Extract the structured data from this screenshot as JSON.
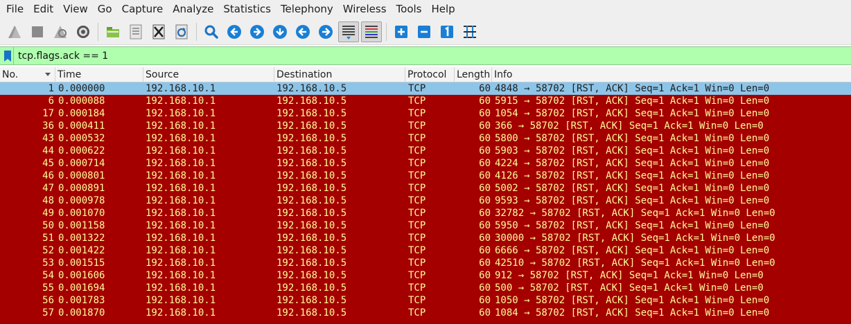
{
  "menu": [
    "File",
    "Edit",
    "View",
    "Go",
    "Capture",
    "Analyze",
    "Statistics",
    "Telephony",
    "Wireless",
    "Tools",
    "Help"
  ],
  "toolbar": {
    "icons": [
      "start-capture-icon",
      "stop-capture-icon",
      "restart-capture-icon",
      "capture-options-icon",
      "open-file-icon",
      "save-file-icon",
      "close-file-icon",
      "reload-file-icon",
      "find-packet-icon",
      "go-back-icon",
      "go-forward-icon",
      "go-to-packet-icon",
      "go-first-icon",
      "go-last-icon",
      "autoscroll-icon",
      "colorize-icon",
      "zoom-in-icon",
      "zoom-out-icon",
      "normal-size-icon",
      "resize-columns-icon"
    ]
  },
  "filter": {
    "value": "tcp.flags.ack == 1"
  },
  "columns": [
    "No.",
    "Time",
    "Source",
    "Destination",
    "Protocol",
    "Length",
    "Info"
  ],
  "colors": {
    "rst_bg": "#a40000",
    "rst_fg": "#fffc9c",
    "selected_bg": "#8dc5e8",
    "filter_ok_bg": "#afffaf"
  },
  "packets": [
    {
      "no": "1",
      "time": "0.000000",
      "src": "192.168.10.1",
      "dst": "192.168.10.5",
      "proto": "TCP",
      "len": "60",
      "info": "4848 → 58702 [RST, ACK] Seq=1 Ack=1 Win=0 Len=0",
      "selected": true
    },
    {
      "no": "6",
      "time": "0.000088",
      "src": "192.168.10.1",
      "dst": "192.168.10.5",
      "proto": "TCP",
      "len": "60",
      "info": "5915 → 58702 [RST, ACK] Seq=1 Ack=1 Win=0 Len=0"
    },
    {
      "no": "17",
      "time": "0.000184",
      "src": "192.168.10.1",
      "dst": "192.168.10.5",
      "proto": "TCP",
      "len": "60",
      "info": "1054 → 58702 [RST, ACK] Seq=1 Ack=1 Win=0 Len=0"
    },
    {
      "no": "36",
      "time": "0.000411",
      "src": "192.168.10.1",
      "dst": "192.168.10.5",
      "proto": "TCP",
      "len": "60",
      "info": "366 → 58702 [RST, ACK] Seq=1 Ack=1 Win=0 Len=0"
    },
    {
      "no": "43",
      "time": "0.000532",
      "src": "192.168.10.1",
      "dst": "192.168.10.5",
      "proto": "TCP",
      "len": "60",
      "info": "5800 → 58702 [RST, ACK] Seq=1 Ack=1 Win=0 Len=0"
    },
    {
      "no": "44",
      "time": "0.000622",
      "src": "192.168.10.1",
      "dst": "192.168.10.5",
      "proto": "TCP",
      "len": "60",
      "info": "5903 → 58702 [RST, ACK] Seq=1 Ack=1 Win=0 Len=0"
    },
    {
      "no": "45",
      "time": "0.000714",
      "src": "192.168.10.1",
      "dst": "192.168.10.5",
      "proto": "TCP",
      "len": "60",
      "info": "4224 → 58702 [RST, ACK] Seq=1 Ack=1 Win=0 Len=0"
    },
    {
      "no": "46",
      "time": "0.000801",
      "src": "192.168.10.1",
      "dst": "192.168.10.5",
      "proto": "TCP",
      "len": "60",
      "info": "4126 → 58702 [RST, ACK] Seq=1 Ack=1 Win=0 Len=0"
    },
    {
      "no": "47",
      "time": "0.000891",
      "src": "192.168.10.1",
      "dst": "192.168.10.5",
      "proto": "TCP",
      "len": "60",
      "info": "5002 → 58702 [RST, ACK] Seq=1 Ack=1 Win=0 Len=0"
    },
    {
      "no": "48",
      "time": "0.000978",
      "src": "192.168.10.1",
      "dst": "192.168.10.5",
      "proto": "TCP",
      "len": "60",
      "info": "9593 → 58702 [RST, ACK] Seq=1 Ack=1 Win=0 Len=0"
    },
    {
      "no": "49",
      "time": "0.001070",
      "src": "192.168.10.1",
      "dst": "192.168.10.5",
      "proto": "TCP",
      "len": "60",
      "info": "32782 → 58702 [RST, ACK] Seq=1 Ack=1 Win=0 Len=0"
    },
    {
      "no": "50",
      "time": "0.001158",
      "src": "192.168.10.1",
      "dst": "192.168.10.5",
      "proto": "TCP",
      "len": "60",
      "info": "5950 → 58702 [RST, ACK] Seq=1 Ack=1 Win=0 Len=0"
    },
    {
      "no": "51",
      "time": "0.001322",
      "src": "192.168.10.1",
      "dst": "192.168.10.5",
      "proto": "TCP",
      "len": "60",
      "info": "30000 → 58702 [RST, ACK] Seq=1 Ack=1 Win=0 Len=0"
    },
    {
      "no": "52",
      "time": "0.001422",
      "src": "192.168.10.1",
      "dst": "192.168.10.5",
      "proto": "TCP",
      "len": "60",
      "info": "6666 → 58702 [RST, ACK] Seq=1 Ack=1 Win=0 Len=0"
    },
    {
      "no": "53",
      "time": "0.001515",
      "src": "192.168.10.1",
      "dst": "192.168.10.5",
      "proto": "TCP",
      "len": "60",
      "info": "42510 → 58702 [RST, ACK] Seq=1 Ack=1 Win=0 Len=0"
    },
    {
      "no": "54",
      "time": "0.001606",
      "src": "192.168.10.1",
      "dst": "192.168.10.5",
      "proto": "TCP",
      "len": "60",
      "info": "912 → 58702 [RST, ACK] Seq=1 Ack=1 Win=0 Len=0"
    },
    {
      "no": "55",
      "time": "0.001694",
      "src": "192.168.10.1",
      "dst": "192.168.10.5",
      "proto": "TCP",
      "len": "60",
      "info": "500 → 58702 [RST, ACK] Seq=1 Ack=1 Win=0 Len=0"
    },
    {
      "no": "56",
      "time": "0.001783",
      "src": "192.168.10.1",
      "dst": "192.168.10.5",
      "proto": "TCP",
      "len": "60",
      "info": "1050 → 58702 [RST, ACK] Seq=1 Ack=1 Win=0 Len=0"
    },
    {
      "no": "57",
      "time": "0.001870",
      "src": "192.168.10.1",
      "dst": "192.168.10.5",
      "proto": "TCP",
      "len": "60",
      "info": "1084 → 58702 [RST, ACK] Seq=1 Ack=1 Win=0 Len=0"
    }
  ]
}
